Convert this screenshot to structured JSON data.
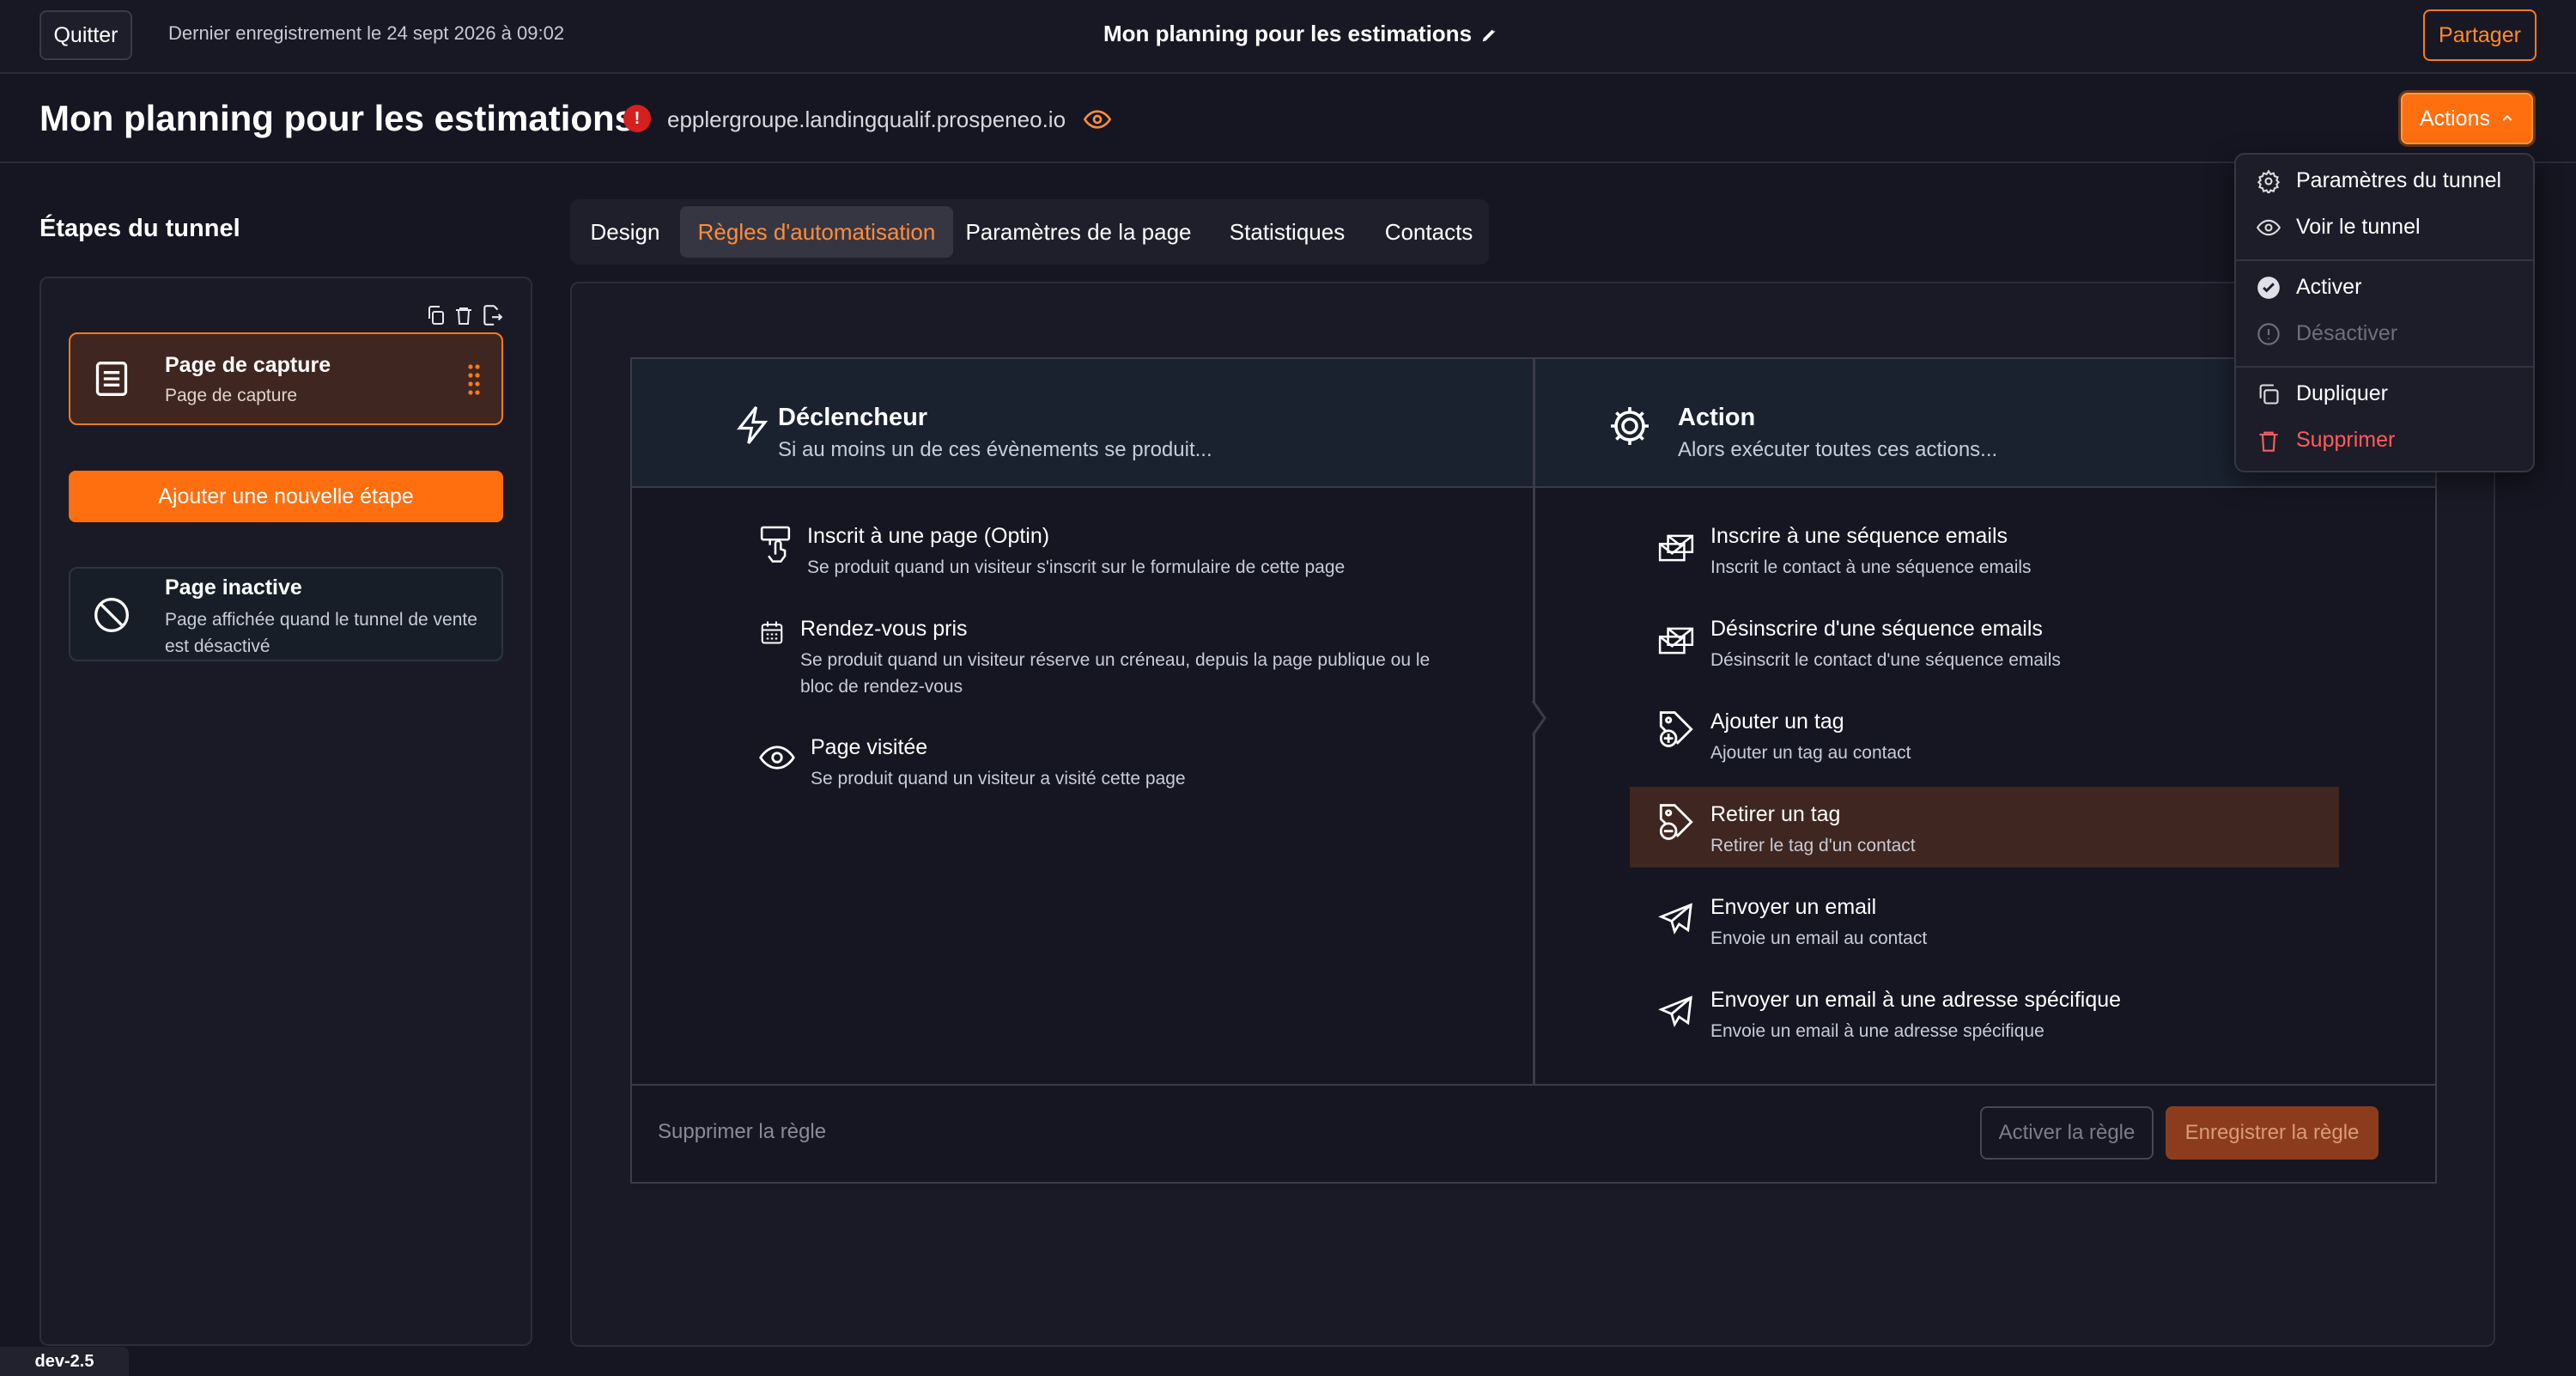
{
  "topbar": {
    "quit_label": "Quitter",
    "last_save": "Dernier enregistrement le 24 sept 2026 à 09:02",
    "title": "Mon planning pour les estimations",
    "share_label": "Partager"
  },
  "header": {
    "title": "Mon planning pour les estimations",
    "error_glyph": "!",
    "domain": "epplergroupe.landingqualif.prospeneo.io",
    "actions_label": "Actions"
  },
  "steps": {
    "title": "Étapes du tunnel",
    "capture": {
      "title": "Page de capture",
      "subtitle": "Page de capture"
    },
    "add_label": "Ajouter une nouvelle étape",
    "inactive": {
      "title": "Page inactive",
      "subtitle": "Page affichée quand le tunnel de vente est désactivé"
    }
  },
  "tabs": [
    {
      "label": "Design"
    },
    {
      "label": "Règles d'automatisation",
      "active": true
    },
    {
      "label": "Paramètres de la page"
    },
    {
      "label": "Statistiques"
    },
    {
      "label": "Contacts"
    }
  ],
  "trigger": {
    "title": "Déclencheur",
    "subtitle": "Si au moins un de ces évènements se produit...",
    "items": [
      {
        "icon": "optin-icon",
        "title": "Inscrit à une page (Optin)",
        "desc": "Se produit quand un visiteur s'inscrit sur le formulaire de cette page"
      },
      {
        "icon": "calendar-icon",
        "title": "Rendez-vous pris",
        "desc": "Se produit quand un visiteur réserve un créneau, depuis la page publique ou le bloc de rendez-vous"
      },
      {
        "icon": "eye-icon",
        "title": "Page visitée",
        "desc": "Se produit quand un visiteur a visité cette page"
      }
    ]
  },
  "action": {
    "title": "Action",
    "subtitle": "Alors exécuter toutes ces actions...",
    "items": [
      {
        "icon": "email-sequence-icon",
        "title": "Inscrire à une séquence emails",
        "desc": "Inscrit le contact à une séquence emails"
      },
      {
        "icon": "email-sequence-icon",
        "title": "Désinscrire d'une séquence emails",
        "desc": "Désinscrit le contact d'une séquence emails"
      },
      {
        "icon": "tag-add-icon",
        "title": "Ajouter un tag",
        "desc": "Ajouter un tag au contact"
      },
      {
        "icon": "tag-remove-icon",
        "title": "Retirer un tag",
        "desc": "Retirer le tag d'un contact",
        "highlighted": true
      },
      {
        "icon": "paper-plane-icon",
        "title": "Envoyer un email",
        "desc": "Envoie un email au contact"
      },
      {
        "icon": "paper-plane-icon",
        "title": "Envoyer un email à une adresse spécifique",
        "desc": "Envoie un email à une adresse spécifique"
      }
    ]
  },
  "footer": {
    "delete_label": "Supprimer la règle",
    "activate_label": "Activer la règle",
    "save_label": "Enregistrer la règle"
  },
  "dropdown": {
    "items": [
      {
        "label": "Paramètres du tunnel",
        "icon": "gear-icon"
      },
      {
        "label": "Voir le tunnel",
        "icon": "eye-icon"
      },
      {
        "label": "Activer",
        "icon": "check-circle-icon"
      },
      {
        "label": "Désactiver",
        "icon": "alert-circle-icon",
        "disabled": true
      },
      {
        "label": "Dupliquer",
        "icon": "copy-icon"
      },
      {
        "label": "Supprimer",
        "icon": "trash-icon",
        "danger": true
      }
    ]
  },
  "version": "dev-2.5",
  "colors": {
    "accent": "#ff6f0f",
    "background": "#161622",
    "danger": "#ff5c5c",
    "error_dot": "#d61f1f",
    "highlight": "#3f2620"
  }
}
